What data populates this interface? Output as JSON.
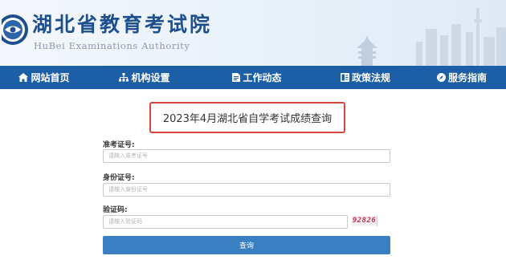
{
  "header": {
    "title": "湖北省教育考试院",
    "subtitle": "HuBei Examinations Authority"
  },
  "nav": {
    "items": [
      {
        "label": "网站首页",
        "icon": "home-icon"
      },
      {
        "label": "机构设置",
        "icon": "org-chart-icon"
      },
      {
        "label": "工作动态",
        "icon": "document-icon"
      },
      {
        "label": "政策法规",
        "icon": "book-icon"
      },
      {
        "label": "服务指南",
        "icon": "compass-icon"
      }
    ]
  },
  "query": {
    "title": "2023年4月湖北省自学考试成绩查询",
    "exam_id_label": "准考证号:",
    "exam_id_placeholder": "请输入准考证号",
    "id_card_label": "身份证号:",
    "id_card_placeholder": "请输入身份证号",
    "captcha_label": "验证码:",
    "captcha_placeholder": "请输入验证码",
    "captcha_code": "92826",
    "submit_label": "查询"
  },
  "colors": {
    "nav_bg": "#1d5fa6",
    "title_border": "#d9453b",
    "button_bg": "#3a7fc2",
    "brand_text": "#1d4f8f"
  }
}
